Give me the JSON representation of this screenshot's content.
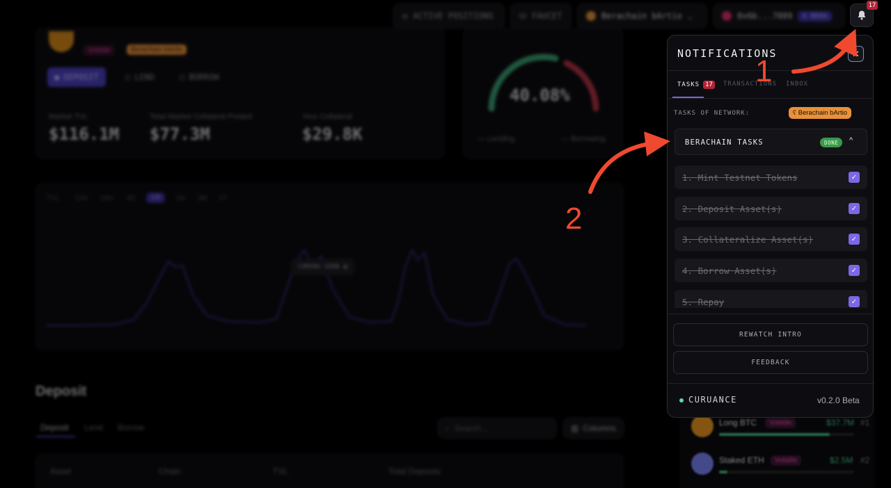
{
  "header": {
    "active_positions": "ACTIVE POSITIONS",
    "faucet": "FAUCET",
    "network": "Berachain bArtio",
    "wallet": "0x6b...7889",
    "wallet_badge": "4 BERA",
    "bell_count": "17"
  },
  "market": {
    "volatile_tag": "Volatile",
    "network_tag": "Berachain bArtio",
    "actions": [
      "DEPOSIT",
      "LEND",
      "BORROW"
    ],
    "stats": [
      {
        "label": "Market TVL",
        "value": "$116.1M"
      },
      {
        "label": "Total Market Collateral Posted",
        "value": "$77.3M"
      },
      {
        "label": "Your Collateral",
        "value": "$29.8K"
      }
    ]
  },
  "gauge": {
    "value": "40.08%",
    "fraction": 0.4008,
    "legend_lending": "Lending",
    "legend_borrowing": "Borrowing"
  },
  "history": {
    "ranges": [
      "TVL",
      "12H",
      "24H",
      "3D",
      "1W",
      "1M",
      "3M",
      "1Y"
    ],
    "coming_soon": "COMING SOON"
  },
  "deposit_section": {
    "title": "Deposit",
    "tabs": [
      "Deposit",
      "Lend",
      "Borrow"
    ],
    "search_placeholder": "Search...",
    "columns_button": "Columns",
    "table_headers": [
      "Asset",
      "Chain",
      "TVL",
      "Total Deposits"
    ]
  },
  "side_list": [
    {
      "name": "Long BTC",
      "tag": "Volatile",
      "value": "$37.7M",
      "rank": "#1",
      "progress": 0.82
    },
    {
      "name": "Staked ETH",
      "tag": "Volatile",
      "value": "$2.5M",
      "rank": "#2",
      "progress": 0.06
    }
  ],
  "notifications": {
    "title": "NOTIFICATIONS",
    "tabs": [
      {
        "label": "TASKS",
        "count": "17"
      },
      {
        "label": "TRANSACTIONS"
      },
      {
        "label": "INBOX"
      }
    ],
    "network_label": "TASKS OF NETWORK:",
    "network_name": "Berachain bArtio",
    "group_title": "BERACHAIN TASKS",
    "group_status": "DONE",
    "tasks": [
      {
        "label": "1.  Mint Testnet Tokens",
        "done": true
      },
      {
        "label": "2.  Deposit Asset(s)",
        "done": true
      },
      {
        "label": "3.  Collateralize Asset(s)",
        "done": true
      },
      {
        "label": "4.  Borrow Asset(s)",
        "done": true
      },
      {
        "label": "5.  Repay",
        "done": true
      }
    ],
    "rewatch_button": "REWATCH INTRO",
    "feedback_button": "FEEDBACK",
    "brand": "CURUANCE",
    "version": "v0.2.0 Beta"
  },
  "annotations": [
    {
      "number": "1",
      "color": "#ef4a2f"
    },
    {
      "number": "2",
      "color": "#ef4a2f"
    }
  ]
}
